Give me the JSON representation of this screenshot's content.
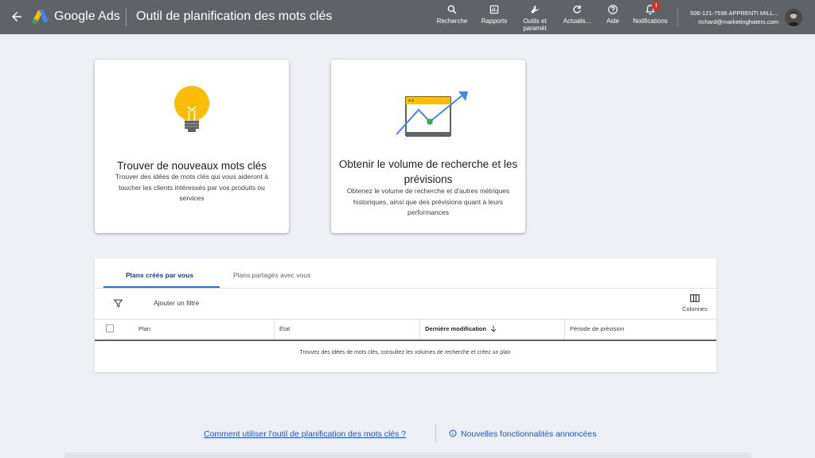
{
  "header": {
    "brand": "Google Ads",
    "title": "Outil de planification des mots clés",
    "tools": [
      {
        "label": "Recherche",
        "icon": "search-icon"
      },
      {
        "label": "Rapports",
        "icon": "reports-icon"
      },
      {
        "label": "Outils et paramèt",
        "icon": "tools-icon"
      },
      {
        "label": "Actualis...",
        "icon": "refresh-icon"
      },
      {
        "label": "Aide",
        "icon": "help-icon"
      },
      {
        "label": "Notifications",
        "icon": "bell-icon",
        "badge": "!"
      }
    ],
    "account_id": "506-121-7596 APPRENTI MILL...",
    "account_email": "richard@marketinghaters.com"
  },
  "cards": {
    "discover": {
      "title": "Trouver de nouveaux mots clés",
      "description": "Trouver des idées de mots clés qui vous aideront à toucher les clients intéressés par vos produits ou services",
      "icon": "lightbulb-icon"
    },
    "forecast": {
      "title": "Obtenir le volume de recherche et les prévisions",
      "description": "Obtenez le volume de recherche et d'autres métriques historiques, ainsi que des prévisions quant à leurs performances",
      "icon": "trend-chart-icon"
    }
  },
  "plans": {
    "tabs": [
      "Plans créés par vous",
      "Plans partagés avec vous"
    ],
    "active_tab": 0,
    "filter_label": "Ajouter un filtre",
    "columns_label": "Colonnes",
    "headers": [
      "Plan",
      "État",
      "Dernière modification",
      "Période de prévision"
    ],
    "sort_column": "Dernière modification",
    "empty_message": "Trouvez des idées de mots clés, consultez les volumes de recherche et créez un plan"
  },
  "footer": {
    "help_link": "Comment utiliser l'outil de planification des mots clés ?",
    "news_link": "Nouvelles fonctionnalités annoncées"
  },
  "colors": {
    "topbar": "#5f6368",
    "accent": "#1a73e8",
    "link": "#1a56c4",
    "background": "#eeeff4",
    "bulb": "#fbbc04"
  }
}
